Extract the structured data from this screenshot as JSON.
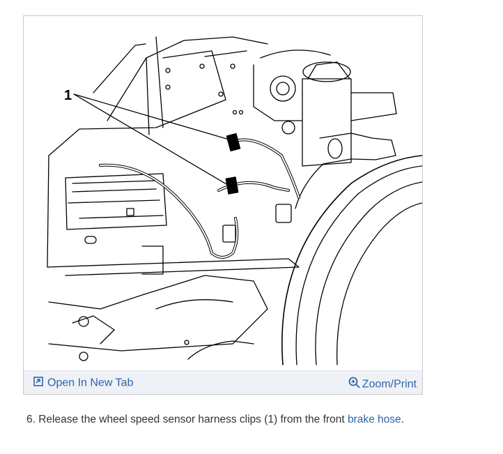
{
  "figure": {
    "callout_label": "1"
  },
  "footer": {
    "open_tab_label": "Open In New Tab",
    "open_tab_icon": "open-in-new-tab-icon",
    "zoom_label": "Zoom/Print",
    "zoom_icon": "zoom-in-magnifier-icon",
    "link_color": "#2f64a8"
  },
  "step": {
    "text_before": "6. Release the wheel speed sensor harness clips (1) from the front ",
    "link_text": "brake hose",
    "text_after": "."
  }
}
